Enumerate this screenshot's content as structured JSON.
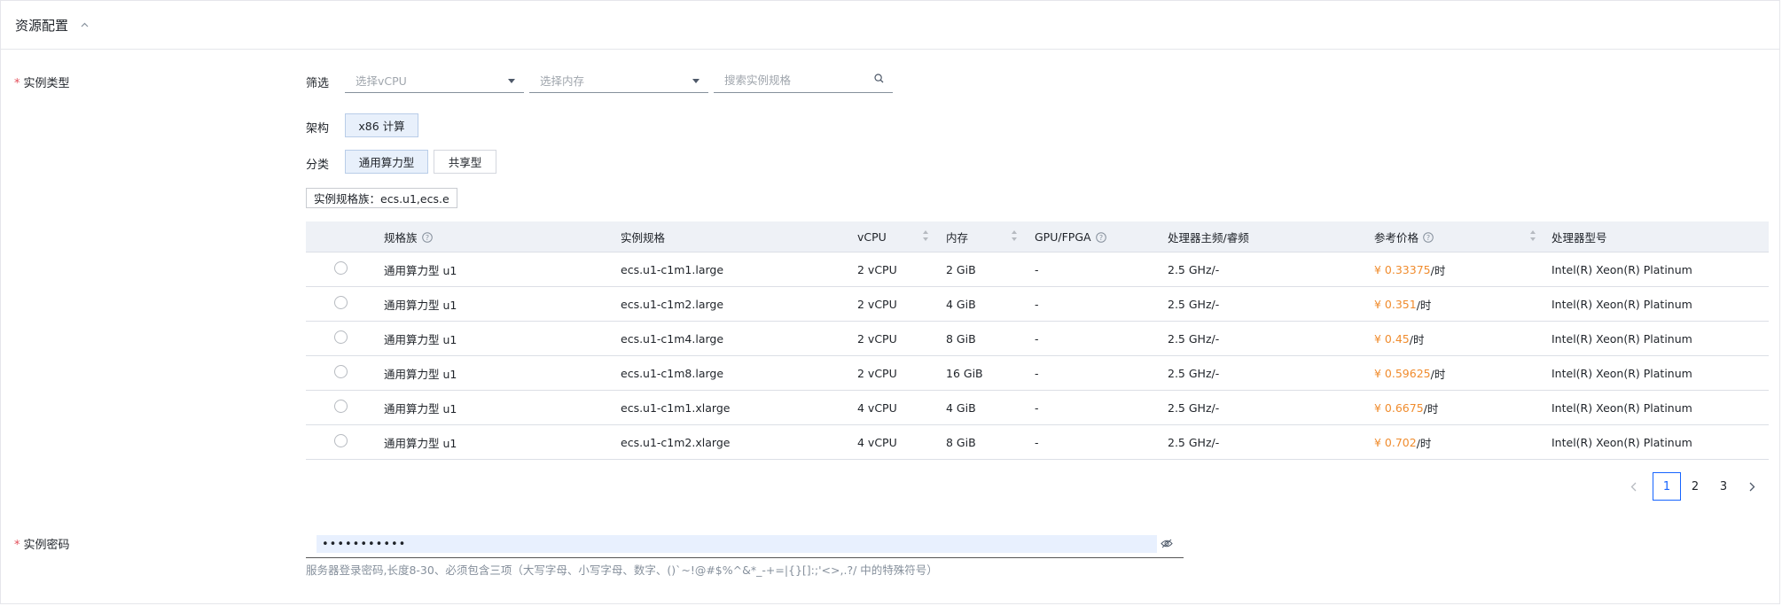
{
  "section": {
    "title": "资源配置"
  },
  "instance_type": {
    "label": "实例类型",
    "required_mark": "*",
    "filter_label": "筛选",
    "vcpu_placeholder": "选择vCPU",
    "memory_placeholder": "选择内存",
    "search_placeholder": "搜索实例规格",
    "arch_label": "架构",
    "arch_option": "x86 计算",
    "category_label": "分类",
    "category_options": [
      "通用算力型",
      "共享型"
    ],
    "family_tag": "实例规格族：ecs.u1,ecs.e"
  },
  "table": {
    "headers": {
      "family": "规格族",
      "spec": "实例规格",
      "vcpu": "vCPU",
      "memory": "内存",
      "gpu": "GPU/FPGA",
      "freq": "处理器主频/睿频",
      "price": "参考价格",
      "cpu_model": "处理器型号"
    },
    "rows": [
      {
        "family": "通用算力型 u1",
        "spec": "ecs.u1-c1m1.large",
        "vcpu": "2 vCPU",
        "memory": "2 GiB",
        "gpu": "-",
        "freq": "2.5 GHz/-",
        "price": "¥ 0.33375",
        "unit": "/时",
        "cpu_model": "Intel(R) Xeon(R) Platinum"
      },
      {
        "family": "通用算力型 u1",
        "spec": "ecs.u1-c1m2.large",
        "vcpu": "2 vCPU",
        "memory": "4 GiB",
        "gpu": "-",
        "freq": "2.5 GHz/-",
        "price": "¥ 0.351",
        "unit": "/时",
        "cpu_model": "Intel(R) Xeon(R) Platinum"
      },
      {
        "family": "通用算力型 u1",
        "spec": "ecs.u1-c1m4.large",
        "vcpu": "2 vCPU",
        "memory": "8 GiB",
        "gpu": "-",
        "freq": "2.5 GHz/-",
        "price": "¥ 0.45",
        "unit": "/时",
        "cpu_model": "Intel(R) Xeon(R) Platinum"
      },
      {
        "family": "通用算力型 u1",
        "spec": "ecs.u1-c1m8.large",
        "vcpu": "2 vCPU",
        "memory": "16 GiB",
        "gpu": "-",
        "freq": "2.5 GHz/-",
        "price": "¥ 0.59625",
        "unit": "/时",
        "cpu_model": "Intel(R) Xeon(R) Platinum"
      },
      {
        "family": "通用算力型 u1",
        "spec": "ecs.u1-c1m1.xlarge",
        "vcpu": "4 vCPU",
        "memory": "4 GiB",
        "gpu": "-",
        "freq": "2.5 GHz/-",
        "price": "¥ 0.6675",
        "unit": "/时",
        "cpu_model": "Intel(R) Xeon(R) Platinum"
      },
      {
        "family": "通用算力型 u1",
        "spec": "ecs.u1-c1m2.xlarge",
        "vcpu": "4 vCPU",
        "memory": "8 GiB",
        "gpu": "-",
        "freq": "2.5 GHz/-",
        "price": "¥ 0.702",
        "unit": "/时",
        "cpu_model": "Intel(R) Xeon(R) Platinum"
      }
    ]
  },
  "pagination": {
    "pages": [
      "1",
      "2",
      "3"
    ],
    "current": "1"
  },
  "password": {
    "label": "实例密码",
    "required_mark": "*",
    "value": "•••••••••••",
    "hint": "服务器登录密码,长度8-30、必须包含三项（大写字母、小写字母、数字、()`~!@#$%^&*_-+=|{}[]:;'<>,.?/ 中的特殊符号）"
  },
  "colors": {
    "accent": "#1664ff",
    "price": "#f08c2e",
    "required": "#e34d59",
    "chip_active_bg": "#e8f0fb"
  },
  "icons": [
    "chevron-up-icon",
    "caret-down-icon",
    "search-icon",
    "help-icon",
    "sort-icon",
    "chevron-left-icon",
    "chevron-right-icon",
    "eye-off-icon"
  ]
}
